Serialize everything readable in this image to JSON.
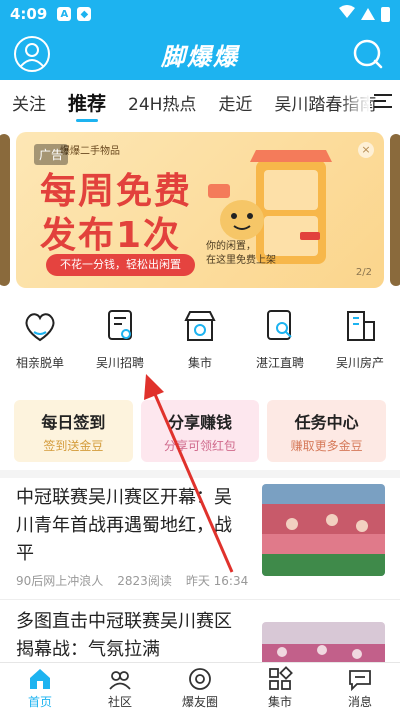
{
  "status_bar": {
    "time": "4:09",
    "icon_a": "A"
  },
  "header": {
    "title": "脚爆爆"
  },
  "tabs": [
    "关注",
    "推荐",
    "24H热点",
    "走近",
    "吴川踏春指南"
  ],
  "banner": {
    "ad_label": "广告",
    "brand": "爆爆二手物品",
    "headline1": "每周免费",
    "headline2": "发布1次",
    "pill": "不花一分钱，轻松出闲置",
    "tagline1": "你的闲置，",
    "tagline2": "在这里免费上架",
    "close_icon": "×",
    "pager": "2/2"
  },
  "grid": [
    {
      "label": "相亲脱单",
      "icon": "heart-chat-icon"
    },
    {
      "label": "吴川招聘",
      "icon": "resume-icon"
    },
    {
      "label": "集市",
      "icon": "store-icon"
    },
    {
      "label": "湛江直聘",
      "icon": "document-search-icon"
    },
    {
      "label": "吴川房产",
      "icon": "building-icon"
    }
  ],
  "tasks": [
    {
      "title": "每日签到",
      "sub": "签到送金豆"
    },
    {
      "title": "分享赚钱",
      "sub": "分享可领红包"
    },
    {
      "title": "任务中心",
      "sub": "赚取更多金豆"
    }
  ],
  "articles": [
    {
      "title": "中冠联赛吴川赛区开幕：吴川青年首战再遇蜀地红，战平",
      "source": "90后网上冲浪人",
      "reads": "2823阅读",
      "time": "昨天 16:34"
    },
    {
      "title": "多图直击中冠联赛吴川赛区揭幕战：气氛拉满"
    }
  ],
  "bottom_nav": [
    {
      "label": "首页",
      "active": true
    },
    {
      "label": "社区"
    },
    {
      "label": "爆友圈"
    },
    {
      "label": "集市"
    },
    {
      "label": "消息"
    }
  ],
  "colors": {
    "brand": "#1db3f0",
    "banner_red": "#e2413c",
    "annotation": "#e0322c"
  }
}
